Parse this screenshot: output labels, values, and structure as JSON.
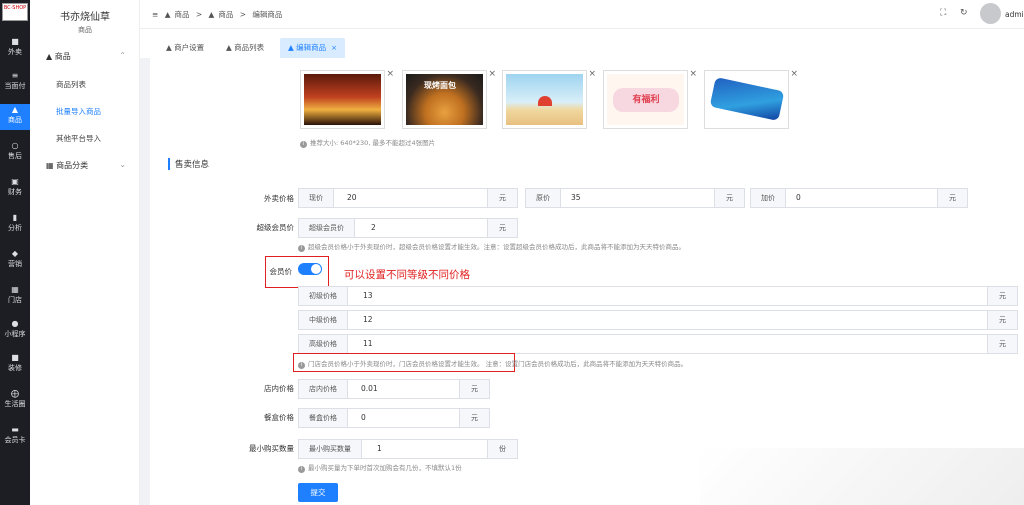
{
  "logo": {
    "text": "BC·SHOP"
  },
  "icon_bar": {
    "items": [
      {
        "label": "外卖",
        "icon": "bag-icon"
      },
      {
        "label": "当面付",
        "icon": "list-icon"
      },
      {
        "label": "商品",
        "icon": "shop-icon",
        "active": true
      },
      {
        "label": "售后",
        "icon": "headset-icon"
      },
      {
        "label": "财务",
        "icon": "wallet-icon"
      },
      {
        "label": "分析",
        "icon": "bar-chart-icon"
      },
      {
        "label": "营销",
        "icon": "gift-icon"
      },
      {
        "label": "门店",
        "icon": "store-icon"
      },
      {
        "label": "小程序",
        "icon": "chat-icon"
      },
      {
        "label": "装修",
        "icon": "paint-icon"
      },
      {
        "label": "生活圈",
        "icon": "circle-icon"
      },
      {
        "label": "会员卡",
        "icon": "card-icon"
      }
    ]
  },
  "menu": {
    "shop_name": "书亦烧仙草",
    "shop_sub": "商品",
    "group_goods": "商品",
    "items": [
      "商品列表",
      "批量导入商品",
      "其他平台导入"
    ],
    "group_category": "商品分类"
  },
  "header": {
    "breadcrumb": [
      "商品",
      "商品",
      "编辑商品"
    ],
    "sep": ">",
    "user": "admin"
  },
  "tabs": [
    {
      "label": "商户设置"
    },
    {
      "label": "商品列表"
    },
    {
      "label": "编辑商品",
      "active": true
    }
  ],
  "images": {
    "tip": "推荐大小: 640*230, 最多不能超过4张图片",
    "banner2_text": "现烤面包",
    "banner4_text": "有福利"
  },
  "sale": {
    "section_title": "售卖信息",
    "takeout_label": "外卖价格",
    "current_price_pre": "现价",
    "current_price": "20",
    "original_price_pre": "原价",
    "original_price": "35",
    "plus_price_pre": "加价",
    "plus_price": "0",
    "yuan": "元",
    "super_label": "超级会员价",
    "super_pre": "超级会员价",
    "super_value": "2",
    "super_tip": "超级会员价格小于外卖现价时，超级会员价格设置才能生效。注意：设置超级会员价格成功后，此商品将不能添加为天天特价商品。",
    "member_label": "会员价",
    "member_on": true,
    "annotation": "可以设置不同等级不同价格",
    "levels": [
      {
        "pre": "初级价格",
        "value": "13"
      },
      {
        "pre": "中级价格",
        "value": "12"
      },
      {
        "pre": "高级价格",
        "value": "11"
      }
    ],
    "member_tip_boxed": "门店会员价格小于外卖现价时，门店会员价格设置才能生效。",
    "member_tip_rest": "注意：设置门店会员价格成功后，此商品将不能添加为天天特价商品。",
    "store_label": "店内价格",
    "store_pre": "店内价格",
    "store_value": "0.01",
    "box_label": "餐盒价格",
    "box_pre": "餐盒价格",
    "box_value": "0",
    "min_label": "最小购买数量",
    "min_pre": "最小购买数量",
    "min_value": "1",
    "fen": "份",
    "min_tip": "最小购买量为下单时首次加购会有几份，不填默认1份",
    "submit": "提交"
  }
}
